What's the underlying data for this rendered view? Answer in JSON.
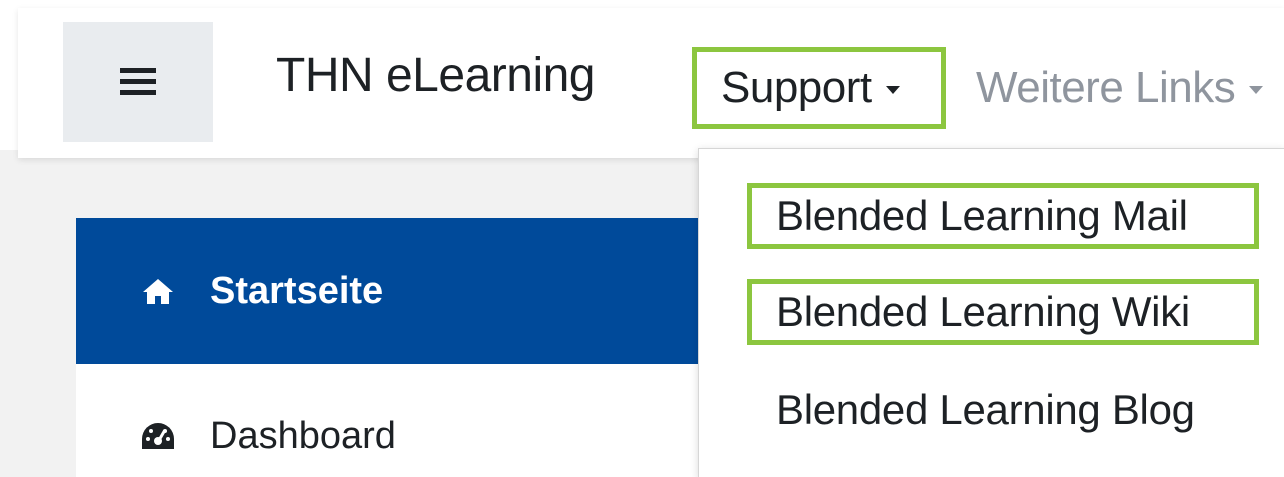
{
  "navbar": {
    "brand": "THN eLearning",
    "menu": [
      {
        "label": "Support",
        "highlighted": true
      },
      {
        "label": "Weitere Links",
        "highlighted": false
      }
    ],
    "menu_icon": "hamburger-icon"
  },
  "dropdown": {
    "items": [
      {
        "label": "Blended Learning Mail",
        "highlighted": true
      },
      {
        "label": "Blended Learning Wiki",
        "highlighted": true
      },
      {
        "label": "Blended Learning Blog",
        "highlighted": false
      }
    ]
  },
  "sidebar": {
    "items": [
      {
        "label": "Startseite",
        "icon": "home-icon",
        "active": true
      },
      {
        "label": "Dashboard",
        "icon": "dashboard-icon",
        "active": false
      }
    ]
  },
  "colors": {
    "highlight": "#8cc63f",
    "active_nav": "#004a9a",
    "text": "#1d2125",
    "muted": "#8f959e"
  }
}
